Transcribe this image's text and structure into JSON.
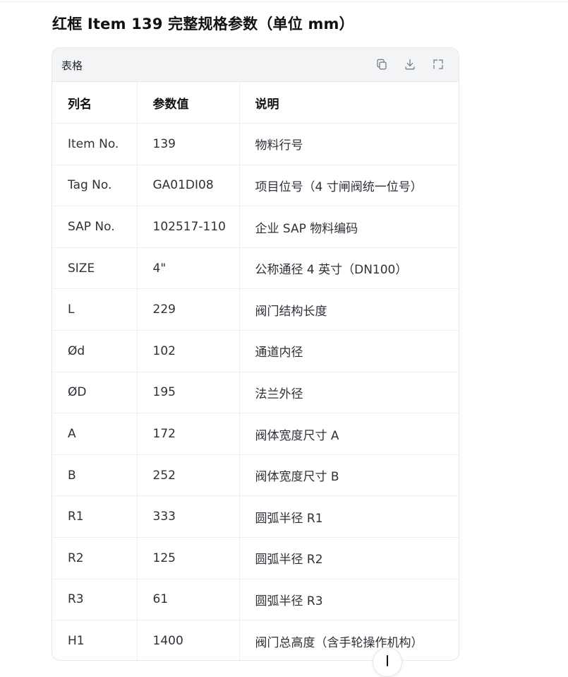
{
  "page": {
    "heading": "红框 Item 139 完整规格参数（单位 mm）"
  },
  "card": {
    "title": "表格",
    "tools": [
      "copy-icon",
      "download-icon",
      "expand-icon"
    ]
  },
  "table": {
    "headers": [
      "列名",
      "参数值",
      "说明"
    ],
    "rows": [
      [
        "Item No.",
        "139",
        "物料行号"
      ],
      [
        "Tag No.",
        "GA01DI08",
        "项目位号（4 寸闸阀统一位号）"
      ],
      [
        "SAP No.",
        "102517-110",
        "企业 SAP 物料编码"
      ],
      [
        "SIZE",
        "4\"",
        "公称通径 4 英寸（DN100）"
      ],
      [
        "L",
        "229",
        "阀门结构长度"
      ],
      [
        "Ød",
        "102",
        "通道内径"
      ],
      [
        "ØD",
        "195",
        "法兰外径"
      ],
      [
        "A",
        "172",
        "阀体宽度尺寸 A"
      ],
      [
        "B",
        "252",
        "阀体宽度尺寸 B"
      ],
      [
        "R1",
        "333",
        "圆弧半径 R1"
      ],
      [
        "R2",
        "125",
        "圆弧半径 R2"
      ],
      [
        "R3",
        "61",
        "圆弧半径 R3"
      ],
      [
        "H1",
        "1400",
        "阀门总高度（含手轮操作机构）"
      ]
    ]
  },
  "scroll_button": {
    "icon": "arrow-down-icon"
  }
}
